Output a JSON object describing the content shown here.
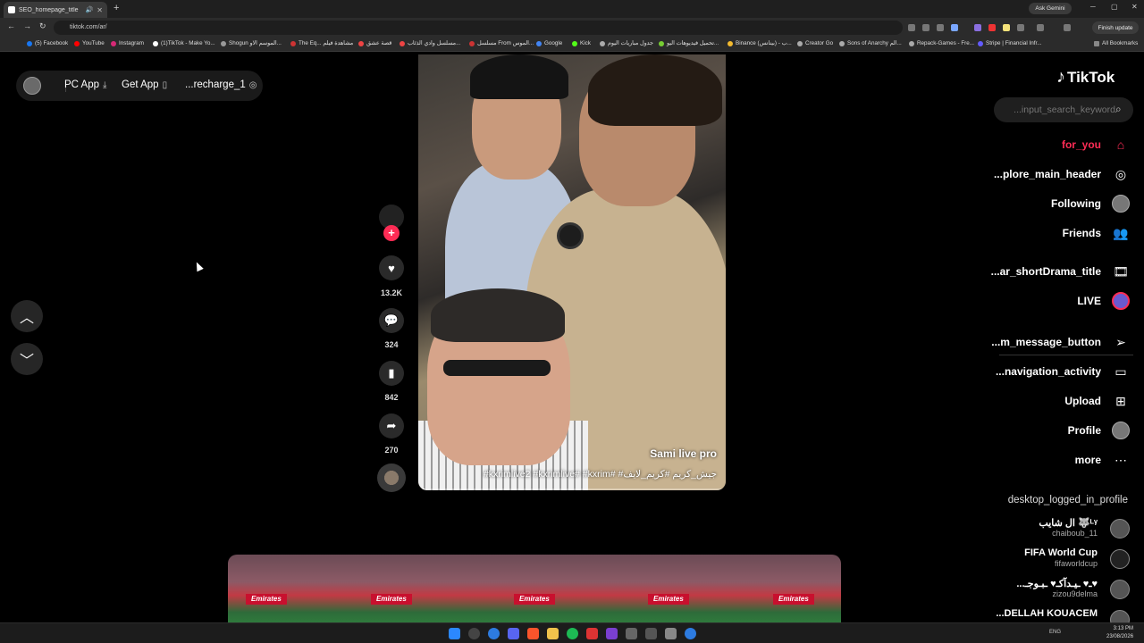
{
  "browser": {
    "tab_title": "SEO_homepage_title",
    "url": "tiktok.com/ar/",
    "ask_gemini": "Ask Gemini",
    "finish_update": "Finish update",
    "all_bookmarks": "All Bookmarks",
    "bookmarks": [
      "(5) Facebook",
      "YouTube",
      "Instagram",
      "(1)TikTok - Make Yo...",
      "Shogun الموسم الاو...",
      "The Eq... مشاهدة فيلم",
      "قصة عشق",
      "مسلسل وادي الذئاب...",
      "مسلسل From الموس...",
      "Google",
      "Kick",
      "جدول مباريات اليوم",
      "تحميل فيديوهات اليو...",
      "Binance (بينانس) - ب...",
      "Creator Go",
      "Sons of Anarchy الم...",
      "Repack-Games - Fre...",
      "Stripe | Financial Infr..."
    ]
  },
  "topbar": {
    "pc_app": "PC App",
    "get_app": "Get App",
    "recharge": "...recharge_1"
  },
  "video": {
    "author": "Sami live pro",
    "caption": "#kxrimlive2 #kxrimlive# #kxrim# #جيش_كريم #كريم_لايف",
    "progress": 0.02
  },
  "actions": {
    "likes": "13.2K",
    "comments": "324",
    "saves": "842",
    "shares": "270"
  },
  "next_video": {
    "banners": [
      "Emirates",
      "Emirates",
      "Emirates",
      "Emirates",
      "Emirates"
    ]
  },
  "sidebar": {
    "logo": "TikTok",
    "search_placeholder": "...input_search_keyword",
    "nav": [
      {
        "label": "for_you",
        "icon": "home-icon",
        "active": true
      },
      {
        "label": "...plore_main_header",
        "icon": "compass-icon"
      },
      {
        "label": "Following",
        "icon": "avatar-icon"
      },
      {
        "label": "Friends",
        "icon": "friends-icon"
      },
      {
        "label": "...ar_shortDrama_title",
        "icon": "film-icon"
      },
      {
        "label": "LIVE",
        "icon": "live-icon"
      },
      {
        "label": "...m_message_button",
        "icon": "send-icon"
      },
      {
        "label": "...navigation_activity",
        "icon": "activity-icon"
      },
      {
        "label": "Upload",
        "icon": "upload-icon"
      },
      {
        "label": "Profile",
        "icon": "profile-avatar-icon"
      },
      {
        "label": "more",
        "icon": "ellipsis-icon"
      }
    ],
    "following_header": "desktop_logged_in_profile",
    "accounts": [
      {
        "name": "ال شايب 🐺ᴸᵞ",
        "handle": "chaiboub_11"
      },
      {
        "name": "FIFA World Cup",
        "handle": "fifaworldcup"
      },
      {
        "name": "...ـ♥ ـيـدآكـ♥ ـبـوجـ♥",
        "handle": "zizou9delma"
      },
      {
        "name": "...DELLAH KOUACEM",
        "handle": ""
      }
    ]
  },
  "taskbar": {
    "lang": "ENG",
    "time": "3:13 PM",
    "date": "23/08/2026"
  },
  "colors": {
    "accent": "#fe2c55",
    "background": "#000000"
  }
}
